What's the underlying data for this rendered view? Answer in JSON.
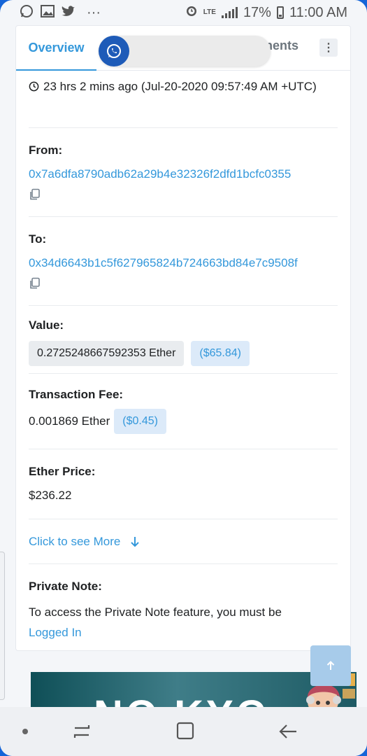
{
  "status_bar": {
    "battery": "17%",
    "time": "11:00 AM",
    "network": "LTE",
    "more": "···"
  },
  "tabs": {
    "overview": "Overview",
    "partial_tab": "nents",
    "more_icon": "vertical-dots-icon"
  },
  "transaction": {
    "timestamp": "23 hrs 2 mins ago (Jul-20-2020 09:57:49 AM +UTC)",
    "from_label": "From:",
    "from_address": "0x7a6dfa8790adb62a29b4e32326f2dfd1bcfc0355",
    "to_label": "To:",
    "to_address": "0x34d6643b1c5f627965824b724663bd84e7c9508f",
    "value_label": "Value:",
    "value_ether": "0.2725248667592353 Ether",
    "value_usd": "($65.84)",
    "fee_label": "Transaction Fee:",
    "fee_ether": "0.001869 Ether",
    "fee_usd": "($0.45)",
    "price_label": "Ether Price:",
    "price_value": "$236.22",
    "see_more": "Click to see More",
    "note_label": "Private Note:",
    "note_text": "To access the Private Note feature, you must be",
    "note_link": "Logged In"
  },
  "banner": {
    "text": "NO KYC"
  },
  "colors": {
    "accent": "#3498db",
    "whatsapp_button": "#1e5bb8"
  }
}
